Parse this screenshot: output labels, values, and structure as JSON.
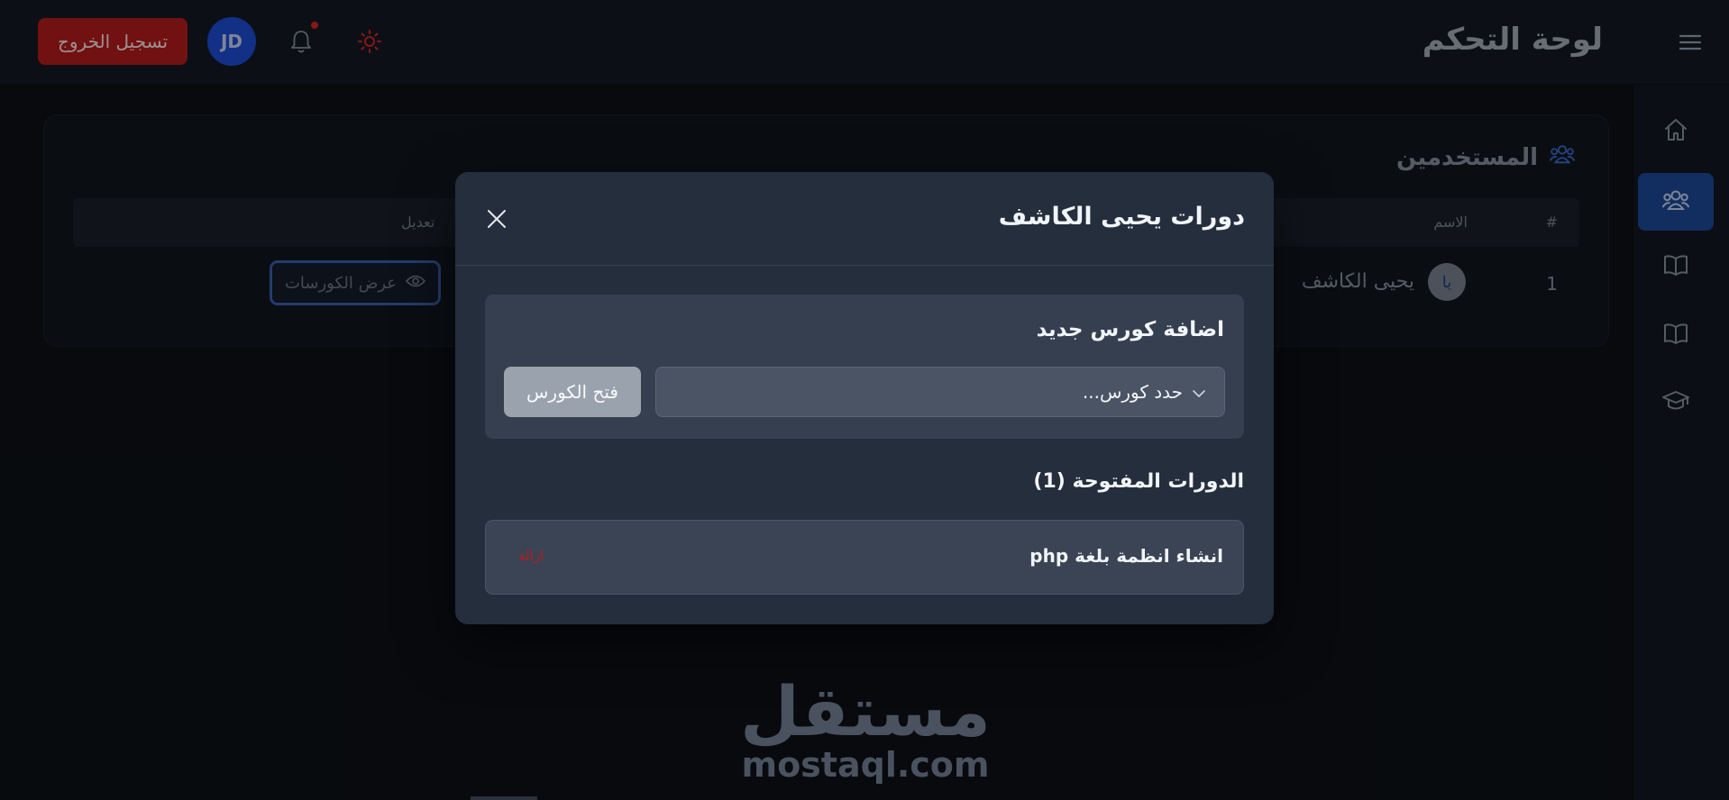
{
  "header": {
    "title": "لوحة التحكم",
    "logout_label": "تسجيل الخروج",
    "avatar_initials": "JD"
  },
  "sidebar": {
    "items": [
      {
        "icon": "home-icon",
        "active": false
      },
      {
        "icon": "users-icon",
        "active": true
      },
      {
        "icon": "book-icon",
        "active": false
      },
      {
        "icon": "book-icon",
        "active": false
      },
      {
        "icon": "graduation-cap-icon",
        "active": false
      }
    ]
  },
  "users": {
    "heading": "المستخدمين",
    "columns": {
      "number": "#",
      "name": "الاسم",
      "edit": "تعديل"
    },
    "rows": [
      {
        "number": "1",
        "avatar": "يا",
        "name": "يحيى الكاشف",
        "action": "عرض الكورسات"
      }
    ]
  },
  "modal": {
    "title": "دورات يحيى الكاشف",
    "add_section_title": "اضافة كورس جديد",
    "select_placeholder": "حدد كورس...",
    "open_button": "فتح الكورس",
    "opened_title": "الدورات المفتوحة (1)",
    "opened_courses": [
      {
        "name": "انشاء انظمة بلغة php",
        "remove_label": "ازالة"
      }
    ]
  },
  "watermark": {
    "arabic": "مستقل",
    "latin": "mostaql.com"
  },
  "colors": {
    "accent": "#1e4a9a",
    "danger": "#b91c1c",
    "background": "#0d1117",
    "modal": "#252e3c"
  }
}
